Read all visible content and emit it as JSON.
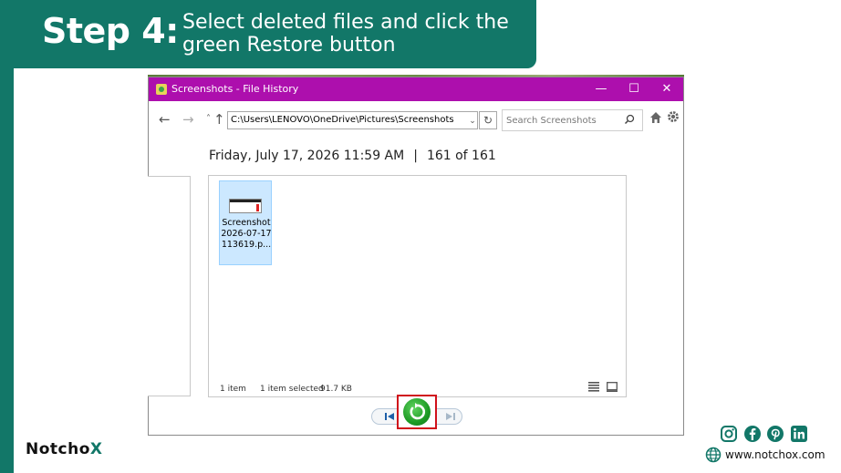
{
  "banner": {
    "step": "Step 4:",
    "instruction_line1": "Select deleted files and click the",
    "instruction_line2": "green Restore button"
  },
  "window": {
    "title": "Screenshots - File History",
    "controls": {
      "minimize": "—",
      "maximize": "☐",
      "close": "✕"
    },
    "titlebar_color": "#ad0fad"
  },
  "nav": {
    "back": "←",
    "forward": "→",
    "recent": "˄",
    "up": "↑",
    "address": "C:\\Users\\LENOVO\\OneDrive\\Pictures\\Screenshots",
    "dropdown": "⌄",
    "refresh": "↻",
    "search_placeholder": "Search Screenshots"
  },
  "snapshot": {
    "date": "Friday, July 17, 2026 11:59 AM",
    "separator": "|",
    "position": "161 of 161"
  },
  "file": {
    "name": "Screenshot 2026-07-17 113619.p..."
  },
  "status": {
    "item_count": "1 item",
    "selected": "1 item selected",
    "size": "91.7 KB"
  },
  "brand": {
    "logo_prefix": "Notch",
    "logo_o": "o",
    "logo_x": "X",
    "website": "www.notchox.com",
    "accent": "#127768",
    "highlight": "#d0111b"
  }
}
